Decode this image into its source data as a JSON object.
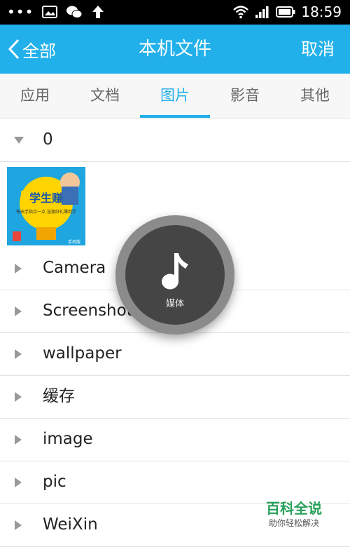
{
  "status_bar": {
    "time": "18:59",
    "dots": "•••"
  },
  "header": {
    "back_label": "全部",
    "title": "本机文件",
    "cancel_label": "取消"
  },
  "tabs": [
    {
      "label": "应用",
      "active": false
    },
    {
      "label": "文档",
      "active": false
    },
    {
      "label": "图片",
      "active": true
    },
    {
      "label": "影音",
      "active": false
    },
    {
      "label": "其他",
      "active": false
    }
  ],
  "folders": {
    "expanded_label": "0",
    "items": [
      "Camera",
      "Screenshots",
      "wallpaper",
      "缓存",
      "image",
      "pic",
      "WeiXin"
    ]
  },
  "thumbnail": {
    "text": "学生赚",
    "subtext": "每天手指点一点\n送惠好礼赚到手",
    "corner": "手机版"
  },
  "media_button": {
    "label": "媒体"
  },
  "watermark": {
    "title": "百科全说",
    "subtitle": "助你轻松解决"
  },
  "colors": {
    "accent": "#22b0ea",
    "text": "#222222",
    "watermark": "#27a05a"
  }
}
